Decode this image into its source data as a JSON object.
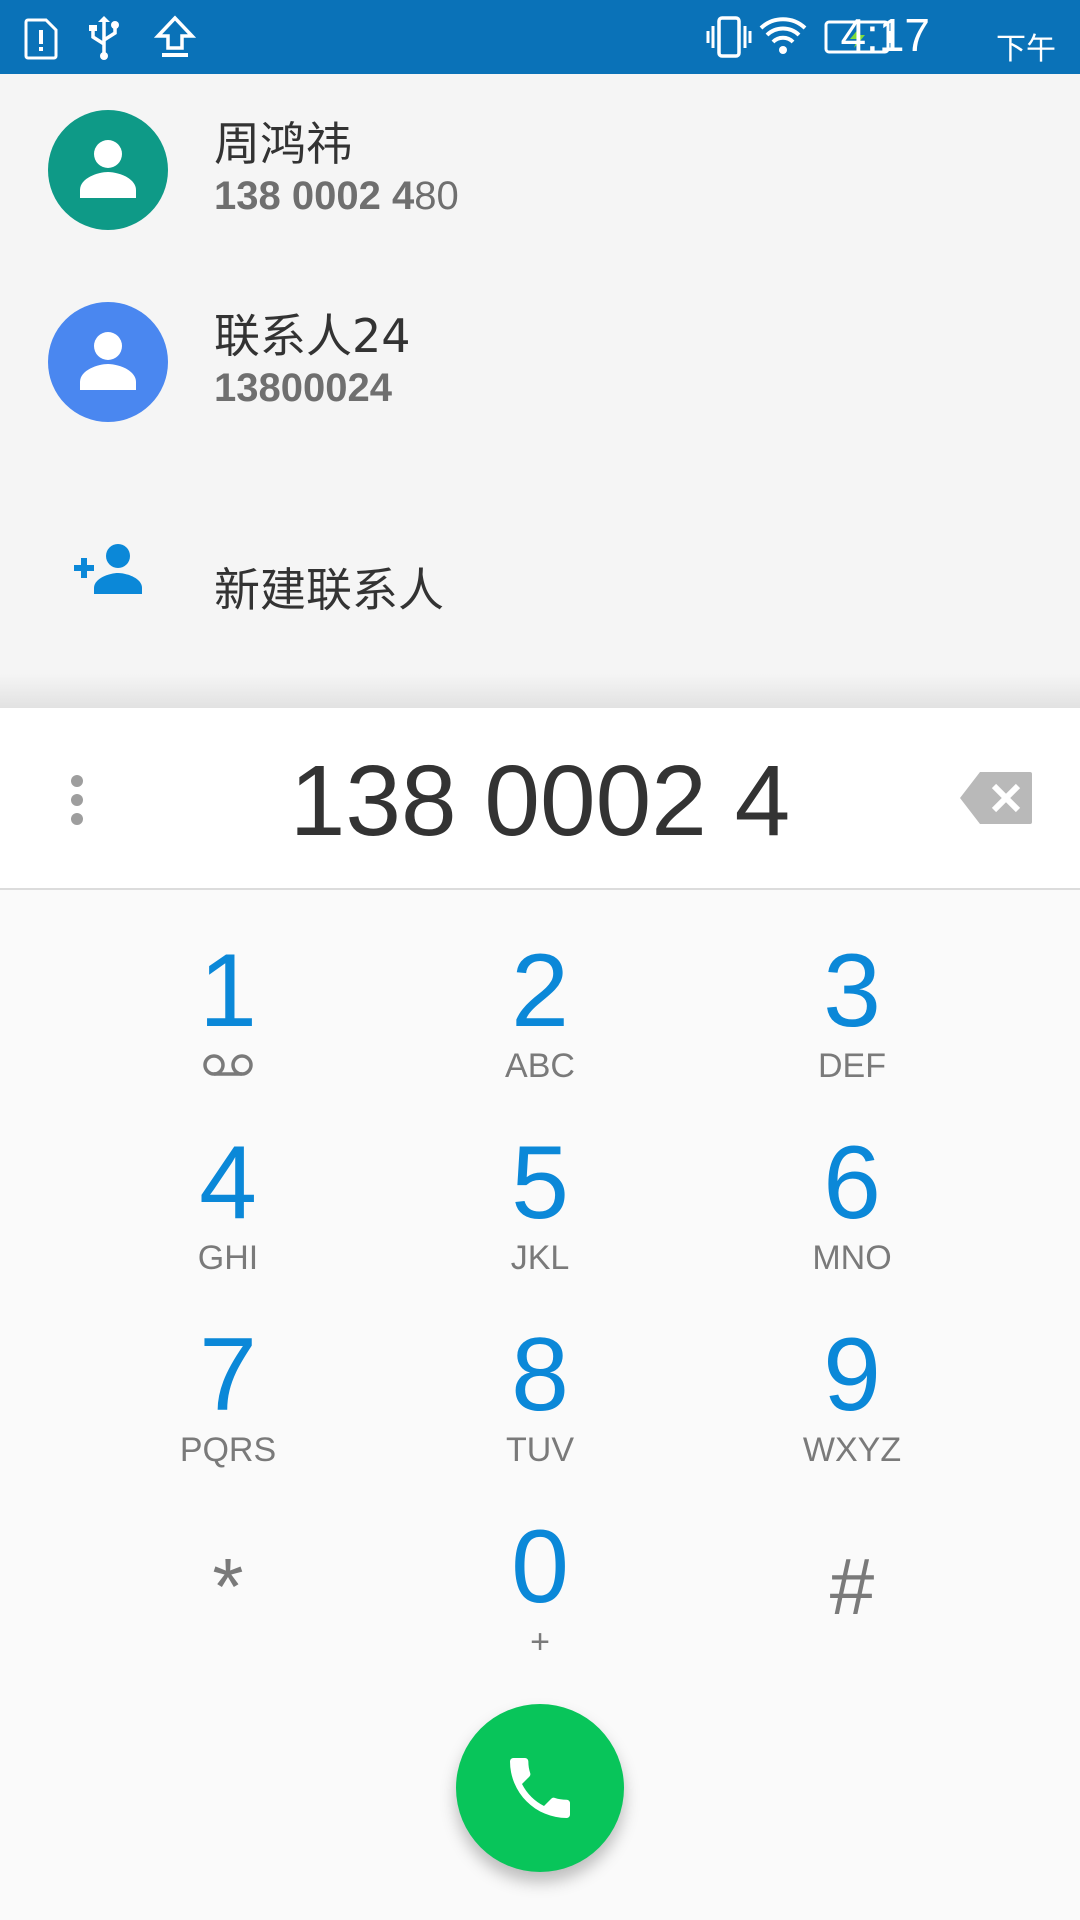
{
  "status_bar": {
    "time": "4:17",
    "ampm": "下午",
    "icons": [
      "alert-card-icon",
      "usb-icon",
      "upload-icon",
      "vibrate-icon",
      "wifi-icon",
      "battery-charging-icon"
    ]
  },
  "suggestions": [
    {
      "name": "周鸿祎",
      "number_match": "138 0002 4",
      "number_rest": "80",
      "avatar_color": "#0e9a87",
      "icon": "person-icon"
    },
    {
      "name": "联系人24",
      "number_match": "13800024",
      "number_rest": "",
      "avatar_color": "#4a87f0",
      "icon": "person-icon"
    }
  ],
  "new_contact": {
    "label": "新建联系人",
    "icon": "add-person-icon",
    "color": "#0b88d8"
  },
  "dialer": {
    "digits": "138 0002 4",
    "overflow_icon": "more-vert-icon",
    "backspace_icon": "backspace-icon"
  },
  "keypad": [
    {
      "digit": "1",
      "letters": "",
      "icon": "voicemail-icon"
    },
    {
      "digit": "2",
      "letters": "ABC"
    },
    {
      "digit": "3",
      "letters": "DEF"
    },
    {
      "digit": "4",
      "letters": "GHI"
    },
    {
      "digit": "5",
      "letters": "JKL"
    },
    {
      "digit": "6",
      "letters": "MNO"
    },
    {
      "digit": "7",
      "letters": "PQRS"
    },
    {
      "digit": "8",
      "letters": "TUV"
    },
    {
      "digit": "9",
      "letters": "WXYZ"
    },
    {
      "digit": "*",
      "letters": ""
    },
    {
      "digit": "0",
      "letters": "+"
    },
    {
      "digit": "#",
      "letters": ""
    }
  ],
  "call_button": {
    "icon": "phone-icon",
    "color": "#08c55a"
  },
  "colors": {
    "status_bar": "#0a72b8",
    "accent": "#0b88d8"
  }
}
